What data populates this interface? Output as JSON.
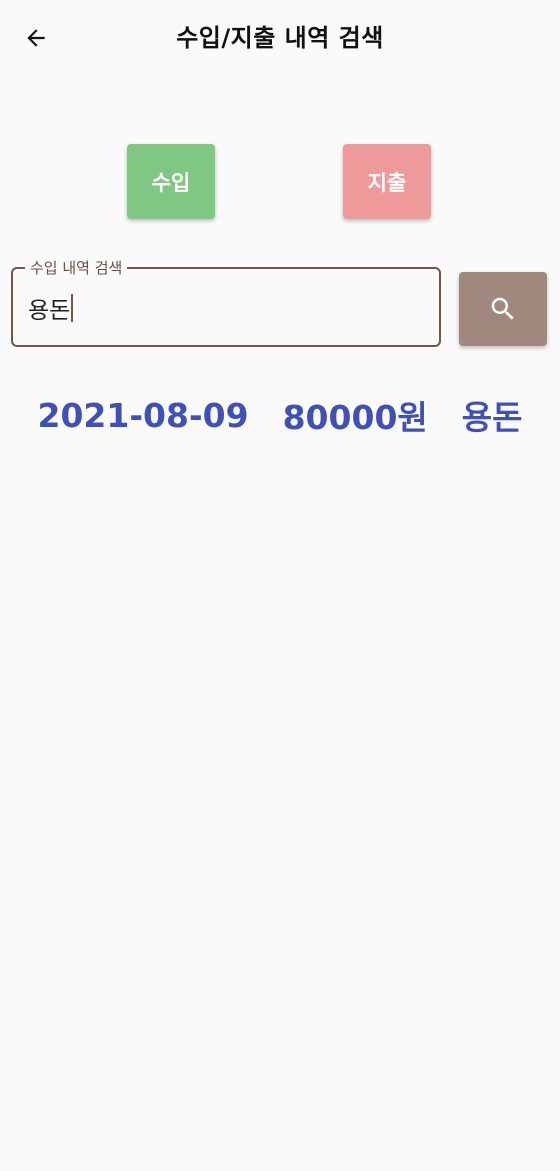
{
  "header": {
    "title": "수입/지출 내역 검색"
  },
  "type_buttons": {
    "income_label": "수입",
    "expense_label": "지출"
  },
  "search": {
    "label": "수입 내역 검색",
    "value": "용돈"
  },
  "results": [
    {
      "date": "2021-08-09",
      "amount": "80000원",
      "memo": "용돈"
    }
  ],
  "colors": {
    "income": "#81c784",
    "expense": "#ef9a9a",
    "search_button": "#a1887f",
    "field_border": "#795548",
    "result_text": "#3f51b5"
  }
}
